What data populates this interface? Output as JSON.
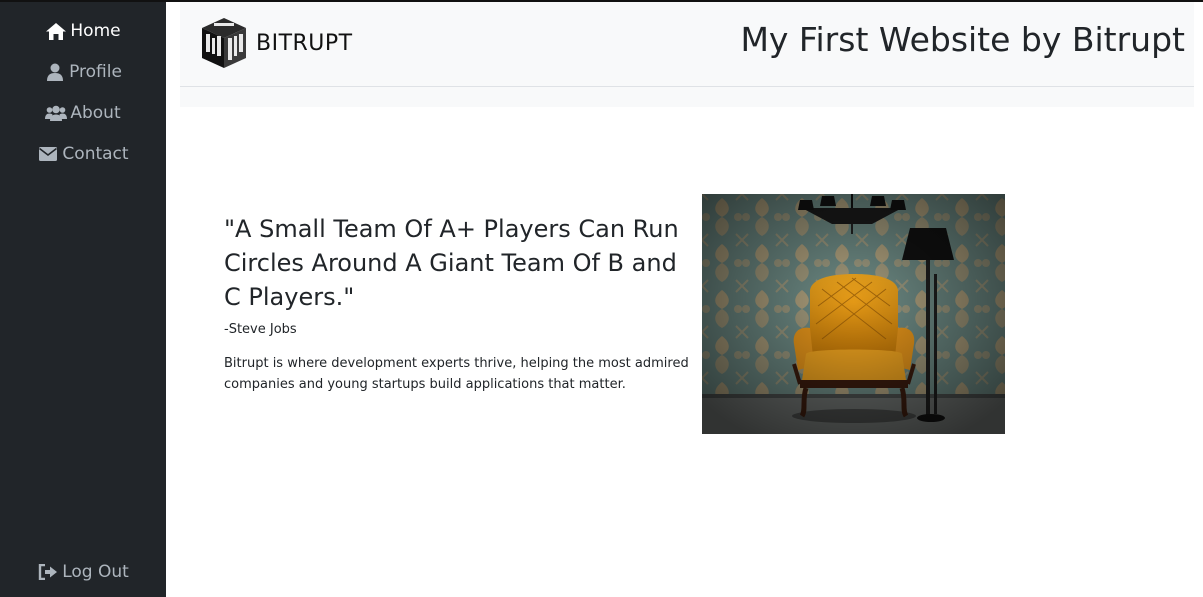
{
  "sidebar": {
    "items": [
      {
        "label": "Home",
        "icon": "home-icon",
        "active": true
      },
      {
        "label": "Profile",
        "icon": "user-icon",
        "active": false
      },
      {
        "label": "About",
        "icon": "users-icon",
        "active": false
      },
      {
        "label": "Contact",
        "icon": "envelope-icon",
        "active": false
      }
    ],
    "logout": {
      "label": "Log Out",
      "icon": "sign-out-icon"
    }
  },
  "header": {
    "brand": "BITRUPT",
    "title": "My First Website by Bitrupt"
  },
  "main": {
    "quote": "\"A Small Team Of A+ Players Can Run Circles Around A Giant Team Of B and C Players.\"",
    "author": "-Steve Jobs",
    "description": "Bitrupt is where development experts thrive, helping the most admired companies and young startups build applications that matter."
  },
  "colors": {
    "sidebar_bg": "#212529",
    "header_bg": "#f8f9fa",
    "nav_text": "#adb5bd",
    "nav_active": "#ffffff"
  }
}
